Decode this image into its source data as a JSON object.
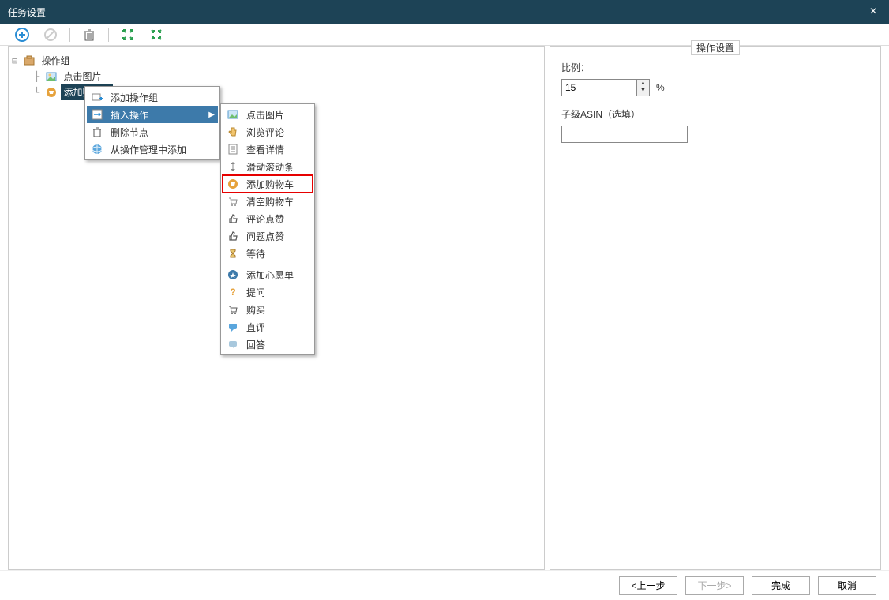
{
  "window": {
    "title": "任务设置"
  },
  "tree": {
    "root": "操作组",
    "items": [
      "点击图片",
      "添加购物车"
    ]
  },
  "context_menu": {
    "items": [
      {
        "label": "添加操作组"
      },
      {
        "label": "插入操作",
        "hover": true,
        "submenu": true
      },
      {
        "label": "删除节点"
      },
      {
        "label": "从操作管理中添加"
      }
    ]
  },
  "submenu": {
    "groups": [
      [
        "点击图片",
        "浏览评论",
        "查看详情",
        "滑动滚动条",
        "添加购物车",
        "清空购物车",
        "评论点赞",
        "问题点赞",
        "等待"
      ],
      [
        "添加心愿单",
        "提问",
        "购买",
        "直评",
        "回答"
      ]
    ],
    "highlighted": "添加购物车"
  },
  "panel": {
    "legend": "操作设置",
    "ratio_label": "比例：",
    "ratio_value": "15",
    "ratio_unit": "%",
    "asin_label": "子级ASIN（选填）",
    "asin_value": ""
  },
  "footer": {
    "prev": "<上一步",
    "next": "下一步>",
    "finish": "完成",
    "cancel": "取消"
  }
}
